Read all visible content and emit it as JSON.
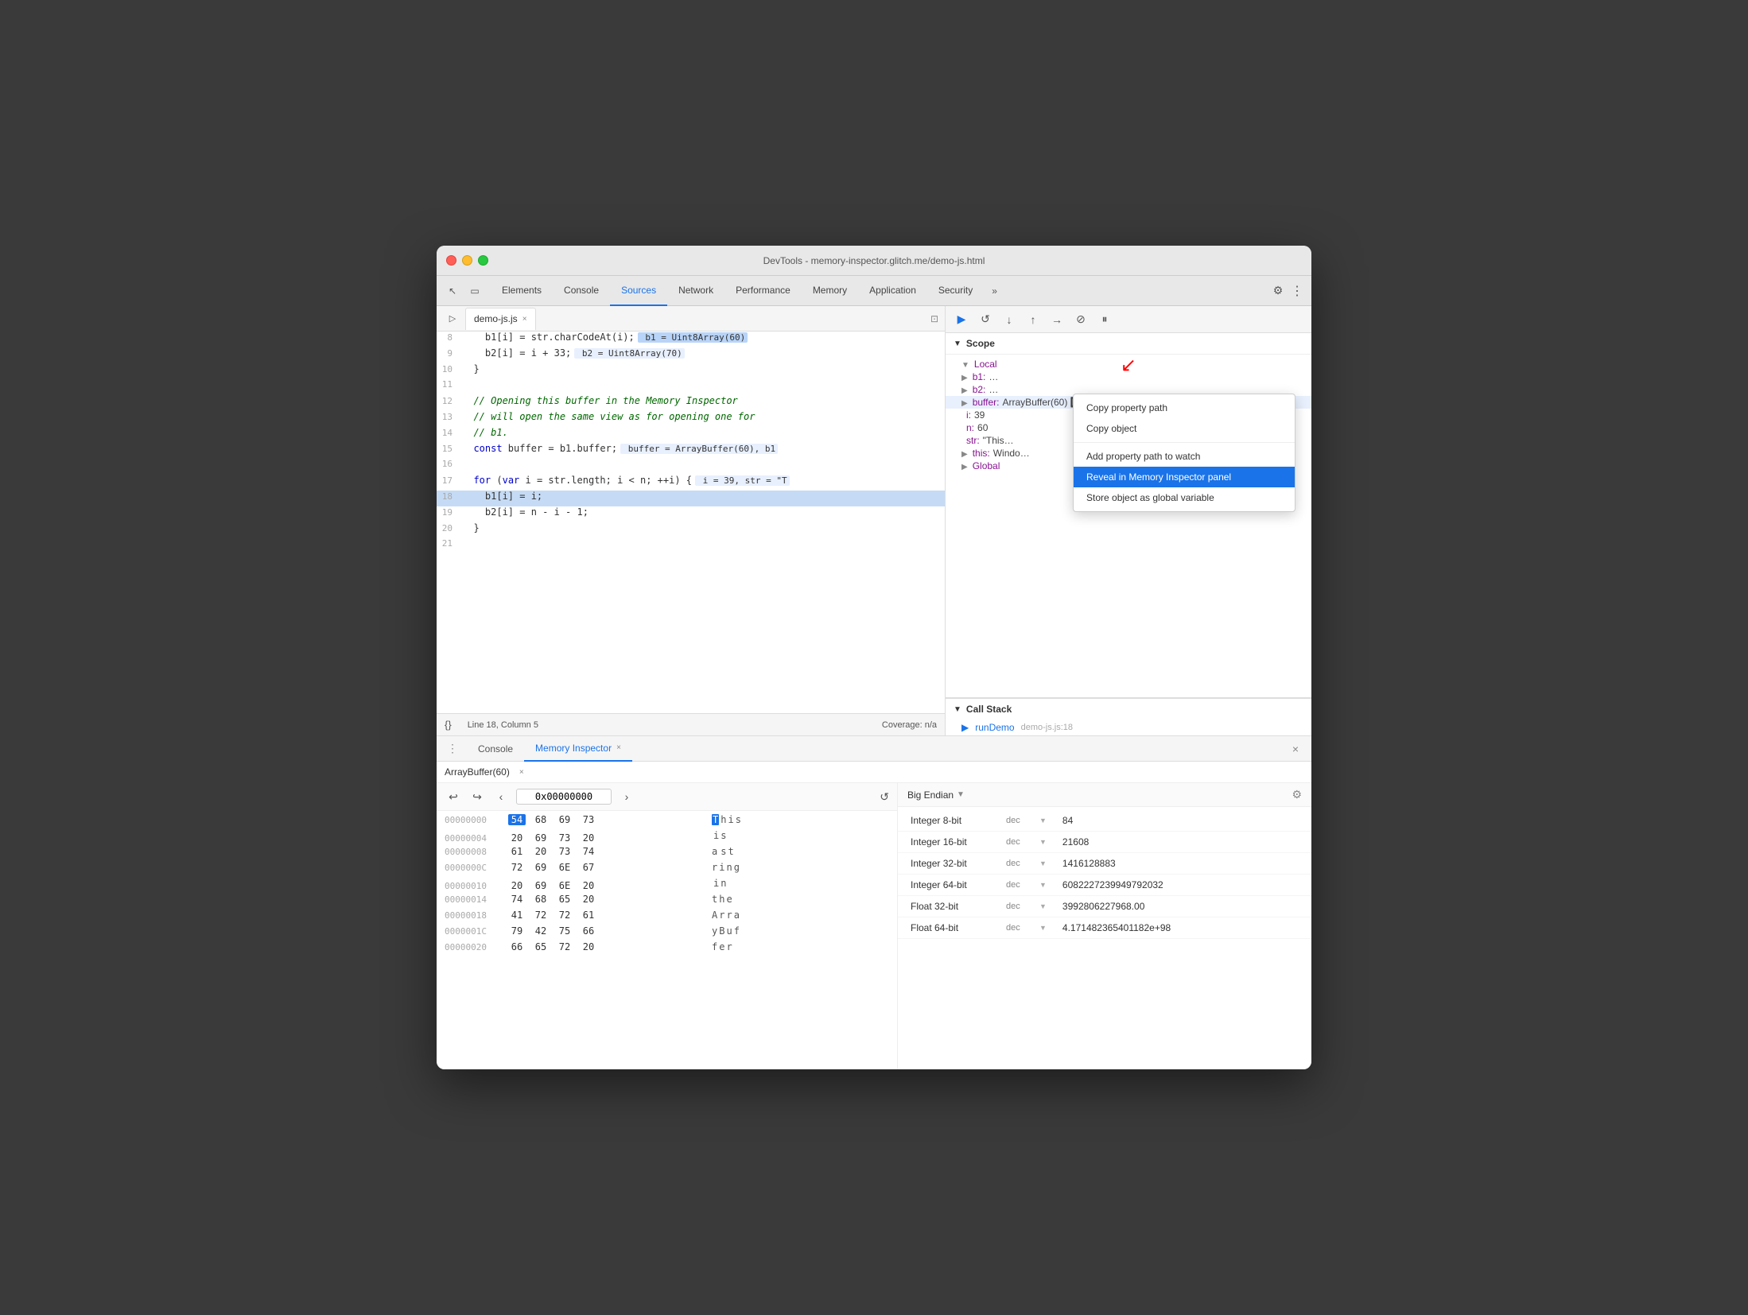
{
  "window": {
    "title": "DevTools - memory-inspector.glitch.me/demo-js.html",
    "traffic_lights": [
      "red",
      "yellow",
      "green"
    ]
  },
  "devtools_tabs": {
    "items": [
      {
        "label": "Elements",
        "active": false
      },
      {
        "label": "Console",
        "active": false
      },
      {
        "label": "Sources",
        "active": true
      },
      {
        "label": "Network",
        "active": false
      },
      {
        "label": "Performance",
        "active": false
      },
      {
        "label": "Memory",
        "active": false
      },
      {
        "label": "Application",
        "active": false
      },
      {
        "label": "Security",
        "active": false
      }
    ],
    "overflow": "»"
  },
  "source_file": {
    "name": "demo-js.js",
    "close": "×"
  },
  "code_lines": [
    {
      "num": "8",
      "content": "    b1[i] = str.charCodeAt(i);  b1 = Uint8Array(60)"
    },
    {
      "num": "9",
      "content": "    b2[i] = i + 33;  b2 = Uint8Array(70)"
    },
    {
      "num": "10",
      "content": "  }"
    },
    {
      "num": "11",
      "content": ""
    },
    {
      "num": "12",
      "content": "  // Opening this buffer in the Memory Inspector"
    },
    {
      "num": "13",
      "content": "  // will open the same view as for opening one for"
    },
    {
      "num": "14",
      "content": "  // b1."
    },
    {
      "num": "15",
      "content": "  const buffer = b1.buffer;  buffer = ArrayBuffer(60), b1"
    },
    {
      "num": "16",
      "content": ""
    },
    {
      "num": "17",
      "content": "  for (var i = str.length; i < n; ++i) {  i = 39, str = \"T"
    },
    {
      "num": "18",
      "content": "    b1[i] = i;",
      "highlighted": true
    },
    {
      "num": "19",
      "content": "    b2[i] = n - i - 1;"
    },
    {
      "num": "20",
      "content": "  }"
    },
    {
      "num": "21",
      "content": ""
    }
  ],
  "status_bar": {
    "line_col": "Line 18, Column 5",
    "coverage": "Coverage: n/a"
  },
  "debug_toolbar": {
    "buttons": [
      "▶",
      "⟳",
      "⬇",
      "⬆",
      "⟶",
      "⊘",
      "⏸"
    ]
  },
  "scope": {
    "header": "Scope",
    "local_header": "Local",
    "items": [
      {
        "key": "b1",
        "val": "…",
        "arrow": "▶"
      },
      {
        "key": "b2",
        "val": "…",
        "arrow": "▶"
      },
      {
        "key": "buffer",
        "val": "ArrayBuffer(60) 🔲",
        "arrow": "▶",
        "selected": true
      },
      {
        "key": "i",
        "val": "39",
        "arrow": ""
      },
      {
        "key": "n",
        "val": "60",
        "arrow": ""
      },
      {
        "key": "str",
        "val": "\"This…",
        "arrow": ""
      },
      {
        "key": "this",
        "val": "Windo…",
        "arrow": "▶"
      }
    ],
    "global_label": "Global"
  },
  "context_menu": {
    "items": [
      {
        "label": "Copy property path",
        "highlighted": false
      },
      {
        "label": "Copy object",
        "highlighted": false
      },
      {
        "divider": true
      },
      {
        "label": "Add property path to watch",
        "highlighted": false
      },
      {
        "label": "Reveal in Memory Inspector panel",
        "highlighted": true
      },
      {
        "label": "Store object as global variable",
        "highlighted": false
      }
    ]
  },
  "call_stack": {
    "header": "Call Stack",
    "items": [
      {
        "fn": "runDemo",
        "file": "demo-js.js:18"
      }
    ]
  },
  "bottom_tabs": {
    "console_label": "Console",
    "mi_label": "Memory Inspector",
    "mi_close": "×",
    "close_btn": "×"
  },
  "memory_inspector": {
    "buffer_tab": "ArrayBuffer(60)",
    "buffer_close": "×",
    "nav": {
      "back": "↩",
      "forward": "↪",
      "prev": "‹",
      "next": "›",
      "address": "0x00000000",
      "refresh": "↺"
    },
    "hex_rows": [
      {
        "addr": "00000000",
        "bytes": [
          "54",
          "68",
          "69",
          "73"
        ],
        "chars": [
          "T",
          "h",
          "i",
          "s"
        ],
        "first_selected": true
      },
      {
        "addr": "00000004",
        "bytes": [
          "20",
          "69",
          "73",
          "20"
        ],
        "chars": [
          "i",
          "s",
          " ",
          " "
        ]
      },
      {
        "addr": "00000008",
        "bytes": [
          "61",
          "20",
          "73",
          "74"
        ],
        "chars": [
          "a",
          " ",
          "s",
          "t"
        ]
      },
      {
        "addr": "0000000C",
        "bytes": [
          "72",
          "69",
          "6E",
          "67"
        ],
        "chars": [
          "r",
          "i",
          "n",
          "g"
        ]
      },
      {
        "addr": "00000010",
        "bytes": [
          "20",
          "69",
          "6E",
          "20"
        ],
        "chars": [
          "i",
          "n",
          " ",
          " "
        ]
      },
      {
        "addr": "00000014",
        "bytes": [
          "74",
          "68",
          "65",
          "20"
        ],
        "chars": [
          "t",
          "h",
          "e",
          " "
        ]
      },
      {
        "addr": "00000018",
        "bytes": [
          "41",
          "72",
          "72",
          "61"
        ],
        "chars": [
          "A",
          "r",
          "r",
          "a"
        ]
      },
      {
        "addr": "0000001C",
        "bytes": [
          "79",
          "42",
          "75",
          "66"
        ],
        "chars": [
          "y",
          "B",
          "u",
          "f"
        ]
      },
      {
        "addr": "00000020",
        "bytes": [
          "66",
          "65",
          "72",
          "20"
        ],
        "chars": [
          "f",
          "e",
          "r",
          " "
        ]
      }
    ],
    "endian": {
      "label": "Big Endian",
      "dropdown": "▼"
    },
    "data_rows": [
      {
        "label": "Integer 8-bit",
        "type": "dec",
        "value": "84"
      },
      {
        "label": "Integer 16-bit",
        "type": "dec",
        "value": "21608"
      },
      {
        "label": "Integer 32-bit",
        "type": "dec",
        "value": "1416128883"
      },
      {
        "label": "Integer 64-bit",
        "type": "dec",
        "value": "6082227239949792032"
      },
      {
        "label": "Float 32-bit",
        "type": "dec",
        "value": "3992806227968.00"
      },
      {
        "label": "Float 64-bit",
        "type": "dec",
        "value": "4.171482365401182e+98"
      }
    ]
  }
}
